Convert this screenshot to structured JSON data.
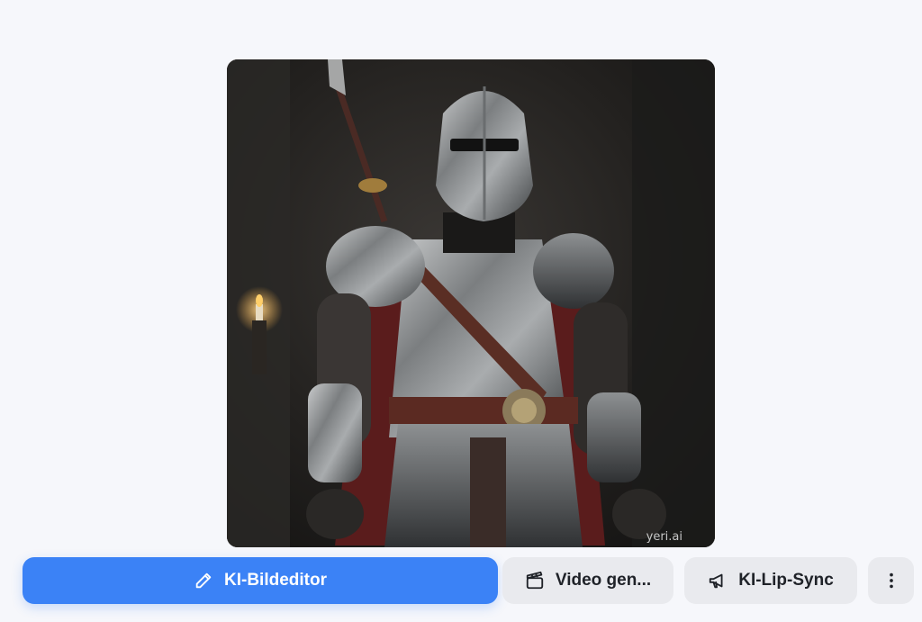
{
  "image": {
    "alt_icon": "generated-image",
    "watermark": "yeri.ai"
  },
  "actions": {
    "editor": {
      "label": "KI-Bildeditor",
      "icon": "pencil-icon"
    },
    "video": {
      "label": "Video gen...",
      "icon": "clapperboard-icon"
    },
    "lipsync": {
      "label": "KI-Lip-Sync",
      "icon": "megaphone-icon"
    },
    "more": {
      "icon": "more-vertical-icon"
    }
  },
  "colors": {
    "primary": "#3b82f6",
    "secondary_bg": "#e9eaee",
    "page_bg": "#f6f7fb"
  }
}
